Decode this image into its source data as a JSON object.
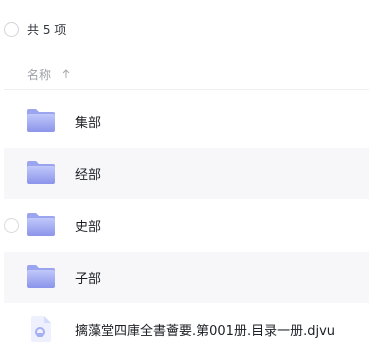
{
  "summary": {
    "count_text": "共 5 项"
  },
  "header": {
    "name_label": "名称"
  },
  "files": [
    {
      "name": "集部",
      "type": "folder"
    },
    {
      "name": "经部",
      "type": "folder"
    },
    {
      "name": "史部",
      "type": "folder"
    },
    {
      "name": "子部",
      "type": "folder"
    },
    {
      "name": "摛藻堂四庫全書薈要.第001册.目录一册.djvu",
      "type": "file"
    }
  ],
  "colors": {
    "folder_light": "#b4bdf7",
    "folder_dark": "#8e98ec",
    "file_icon": "#c3c9f5",
    "row_alt_bg": "#f7f7f9"
  },
  "icons": {
    "sort": "arrow-up-icon",
    "folder": "folder-icon",
    "file": "file-icon"
  }
}
